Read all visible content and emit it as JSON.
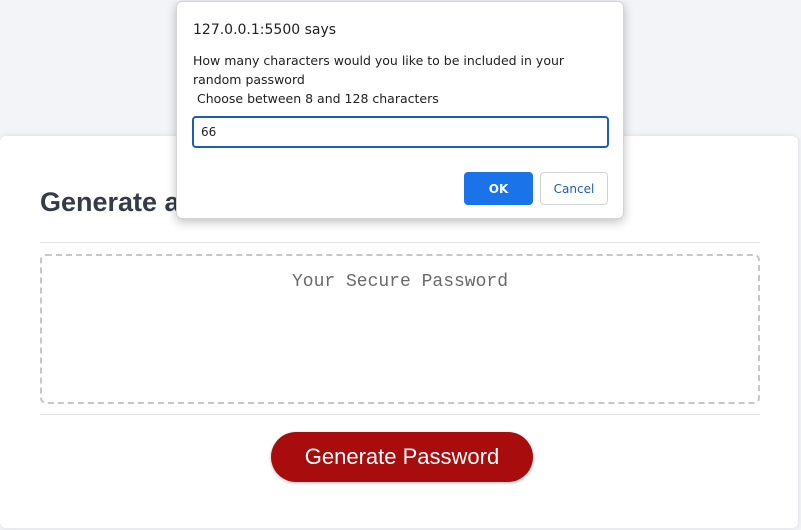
{
  "page": {
    "background_color": "#f3f4f8"
  },
  "card": {
    "title": "Generate a Password",
    "password_placeholder": "Your Secure Password",
    "password_value": "",
    "generate_label": "Generate Password",
    "generate_color": "#a80c0c"
  },
  "dialog": {
    "origin": "127.0.0.1:5500 says",
    "message_line1": "How many characters would you like to be included in your random password",
    "message_line2": " Choose between 8 and 128 characters",
    "input_value": "66",
    "ok_label": "OK",
    "cancel_label": "Cancel",
    "accent_color": "#1a73e8"
  }
}
